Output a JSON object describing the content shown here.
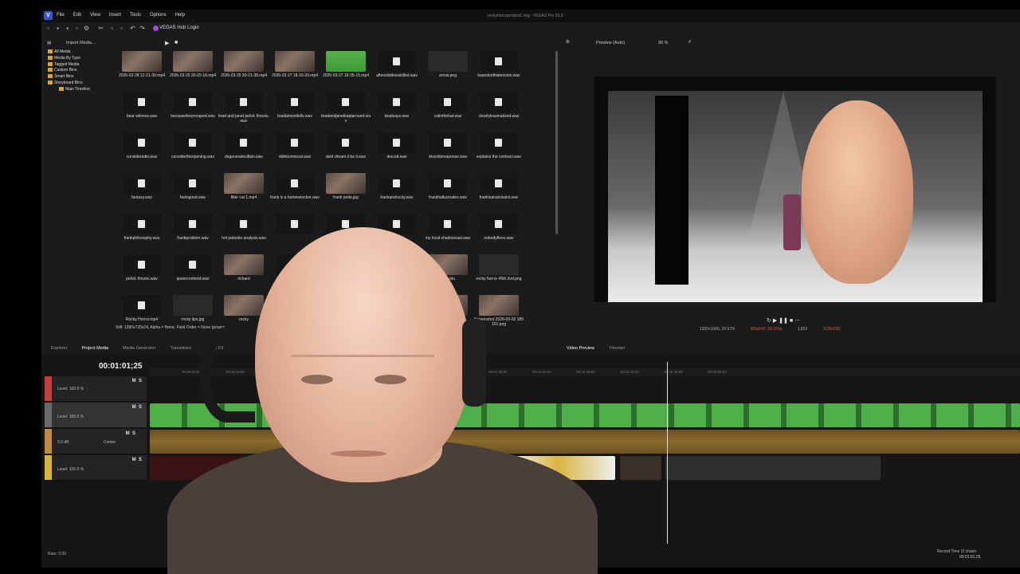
{
  "app": {
    "title": "rockyhorrorproject1.veg - VEGAS Pro 23.0",
    "logo": "V"
  },
  "menu": [
    "File",
    "Edit",
    "View",
    "Insert",
    "Tools",
    "Options",
    "Help"
  ],
  "toolbar": {
    "hub_label": "VEGAS Hub Login"
  },
  "project_media": {
    "toolbar_label": "Import Media...",
    "tree": [
      "All Media",
      "Media By Type",
      "Tagged Media",
      "Custom Bins",
      "Smart Bins",
      "Storyboard Bins",
      "Main Timeline"
    ],
    "items": [
      {
        "name": "2026-02-28 12-21-30.mp4",
        "kind": "vid"
      },
      {
        "name": "2026-03-25 20-20-18.mp4",
        "kind": "vid"
      },
      {
        "name": "2026-03-25 20-21-38.mp4",
        "kind": "vid"
      },
      {
        "name": "2026-03-27 18-16-29.mp4",
        "kind": "vid"
      },
      {
        "name": "2026-03-27 18-35-15.mp4",
        "kind": "green"
      },
      {
        "name": "afteredddeisskilled.wav",
        "kind": "wav"
      },
      {
        "name": "arrow.png",
        "kind": "red"
      },
      {
        "name": "basedonthistension.wav",
        "kind": "wav"
      },
      {
        "name": "bear witness.wav",
        "kind": "wav"
      },
      {
        "name": "becausetheyreraped.wav",
        "kind": "wav"
      },
      {
        "name": "brad and janet pelvic thrusts.wav",
        "kind": "wav"
      },
      {
        "name": "bradalmosttells.wav",
        "kind": "wav"
      },
      {
        "name": "bradandjanetkeptaround.wav",
        "kind": "wav"
      },
      {
        "name": "bradsays.wav",
        "kind": "wav"
      },
      {
        "name": "catinthehat.wav",
        "kind": "wav"
      },
      {
        "name": "clearlytraumatized.wav",
        "kind": "wav"
      },
      {
        "name": "consideredie.wav",
        "kind": "wav"
      },
      {
        "name": "considertheopening.wav",
        "kind": "wav"
      },
      {
        "name": "degeneratevillain.wav",
        "kind": "wav"
      },
      {
        "name": "didntcomeout.wav",
        "kind": "wav"
      },
      {
        "name": "dont dream it be it.wav",
        "kind": "wav"
      },
      {
        "name": "drscott.wav",
        "kind": "wav"
      },
      {
        "name": "drscottsresponse.wav",
        "kind": "wav"
      },
      {
        "name": "explains the contract.wav",
        "kind": "wav"
      },
      {
        "name": "fantasy.wav",
        "kind": "wav"
      },
      {
        "name": "feelsgood.wav",
        "kind": "wav"
      },
      {
        "name": "filler cat 1.mp4",
        "kind": "vid"
      },
      {
        "name": "frank is a homewrecker.wav",
        "kind": "wav"
      },
      {
        "name": "frank pride.jpg",
        "kind": "vid"
      },
      {
        "name": "frankandrocky.wav",
        "kind": "wav"
      },
      {
        "name": "frankhallucinates.wav",
        "kind": "wav"
      },
      {
        "name": "frankisanarcissist.wav",
        "kind": "wav"
      },
      {
        "name": "frankphilosophy.wav",
        "kind": "wav"
      },
      {
        "name": "frankproblem.wav",
        "kind": "wav"
      },
      {
        "name": "hot patootie analysis.wav",
        "kind": "wav"
      },
      {
        "name": "",
        "kind": "wav"
      },
      {
        "name": "",
        "kind": "wav"
      },
      {
        "name": "",
        "kind": "wav"
      },
      {
        "name": "my local shadowcast.wav",
        "kind": "wav"
      },
      {
        "name": "nobodyflees.wav",
        "kind": "wav"
      },
      {
        "name": "pelvic thrusts.wav",
        "kind": "wav"
      },
      {
        "name": "queercontend.wav",
        "kind": "wav"
      },
      {
        "name": "richard",
        "kind": "vid"
      },
      {
        "name": "",
        "kind": "wav"
      },
      {
        "name": "",
        "kind": "wav"
      },
      {
        "name": "",
        "kind": "wav"
      },
      {
        "name": "45th blu",
        "kind": "vid"
      },
      {
        "name": "rocky horror 45th dvd.png",
        "kind": "red"
      },
      {
        "name": "Rocky Horror.mp4",
        "kind": "wav"
      },
      {
        "name": "rocky lips.jpg",
        "kind": "red"
      },
      {
        "name": "rocky",
        "kind": "vid"
      },
      {
        "name": "",
        "kind": "wav"
      },
      {
        "name": "",
        "kind": "wav"
      },
      {
        "name": "",
        "kind": "wav"
      },
      {
        "name": "",
        "kind": "vid"
      },
      {
        "name": "Screenshot 2026-03-02 185151.png",
        "kind": "vid"
      }
    ],
    "status": "Still: 1280x720x24, Alpha = None, Field Order = None (progre"
  },
  "preview": {
    "mode": "Preview (Auto)",
    "zoom": "90 %",
    "project_info": "1920x1080, 29.970i",
    "preview_info": "960x540, 29.970p",
    "frame": "1,853",
    "display": "1120x630"
  },
  "tabs_left": [
    "Explorer",
    "Project Media",
    "Media Generator",
    "Transitions",
    "Video FX"
  ],
  "tabs_right": [
    "Video Preview",
    "Trimmer"
  ],
  "timeline": {
    "timecode": "00:01:01;25",
    "ruler": [
      "00:00:00;00",
      "00:00:15;00",
      "00:00:30;00",
      "00:00:45;00",
      "00:01:00;00",
      "00:01:15;00",
      "00:01:30;00",
      "00:01:45;00",
      "00:02:00;00",
      "00:02:15;00",
      "00:02:30;00",
      "00:02:45;00",
      "00:03:00;00"
    ],
    "tracks": [
      {
        "level": "Level: 100.0 %",
        "color": "#c04040"
      },
      {
        "level": "Level: 100.0 %",
        "color": "#6a6a6a"
      },
      {
        "level": "0.0 dB",
        "pan": "Center",
        "color": "#c08a40"
      },
      {
        "level": "Level: 100.0 %",
        "color": "#d8b440"
      }
    ],
    "rate": "Rate: 0.00",
    "end_tc": "00:01:01;25"
  },
  "record_time": "Record Time (2 chann",
  "colors": {
    "accent": "#3a55c8",
    "green_clip": "#4caf48",
    "audio_clip": "#8a6a2e",
    "video_dark": "#2f2f30"
  }
}
